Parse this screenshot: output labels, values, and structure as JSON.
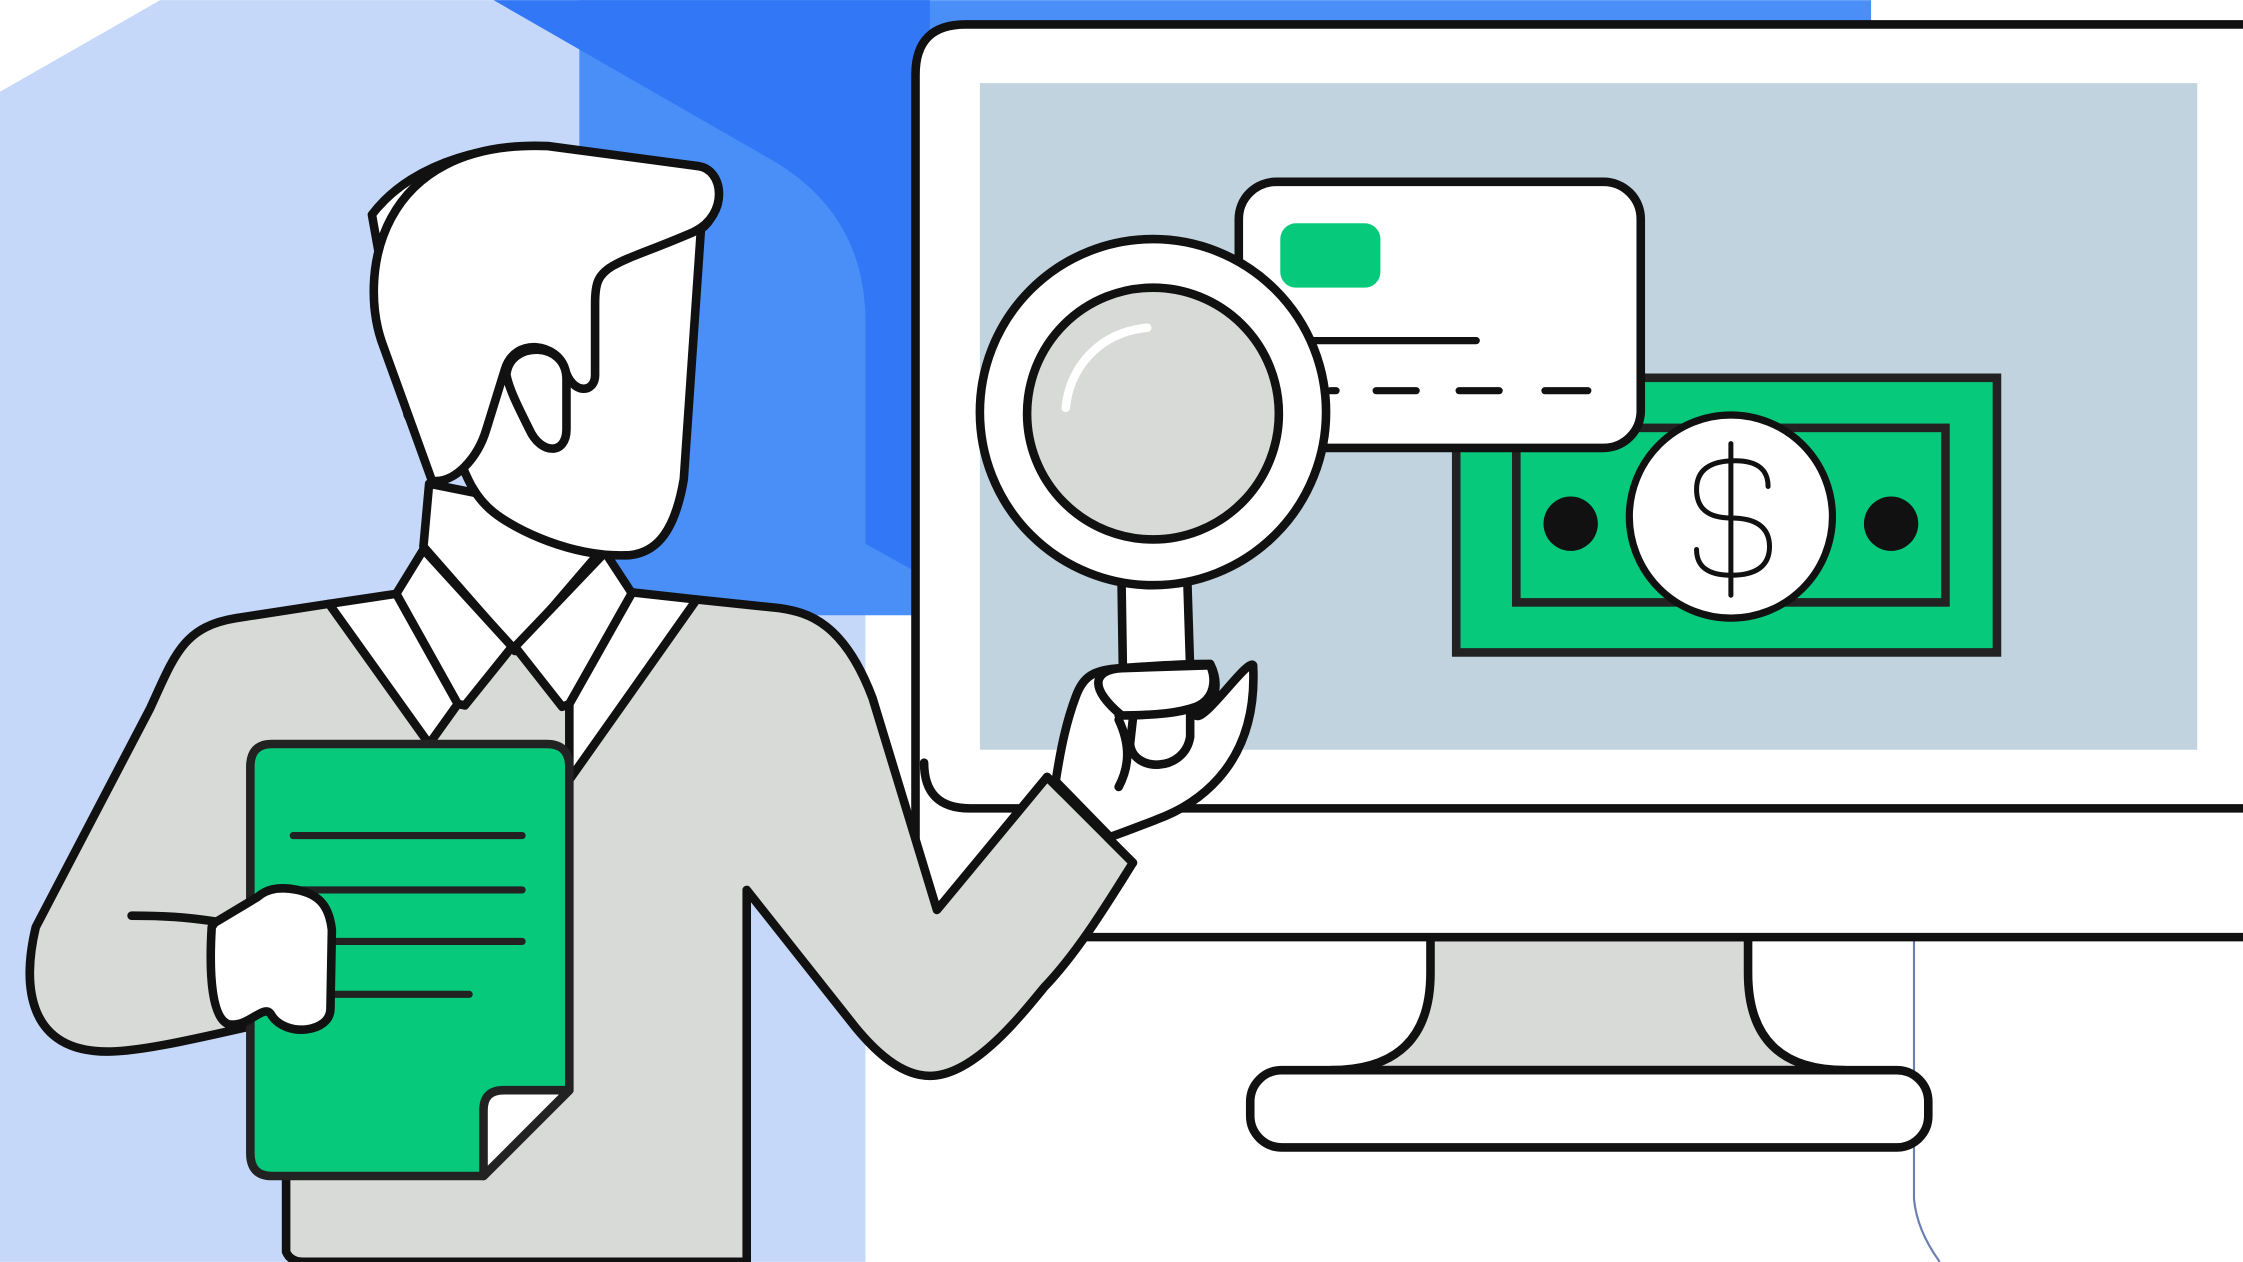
{
  "colors": {
    "background": "#ffffff",
    "hexagon_light": "#c5d8fa",
    "panel_blue": "#4a8ff7",
    "overlap_blue": "#3277f6",
    "screen": "#c0d3df",
    "money_green": "#06c97b",
    "document_green": "#06c97b",
    "suit_gray": "#d8dad8",
    "lens_gray": "#d8dad8",
    "outline": "#111111",
    "thin_line": "#6b7fb0"
  },
  "icons": {
    "monitor": "desktop-monitor-icon",
    "card": "credit-card-icon",
    "banknote": "banknote-icon",
    "currency": "dollar-sign-icon",
    "magnifier": "magnifying-glass-icon",
    "document": "document-icon",
    "person": "businessman-icon"
  }
}
